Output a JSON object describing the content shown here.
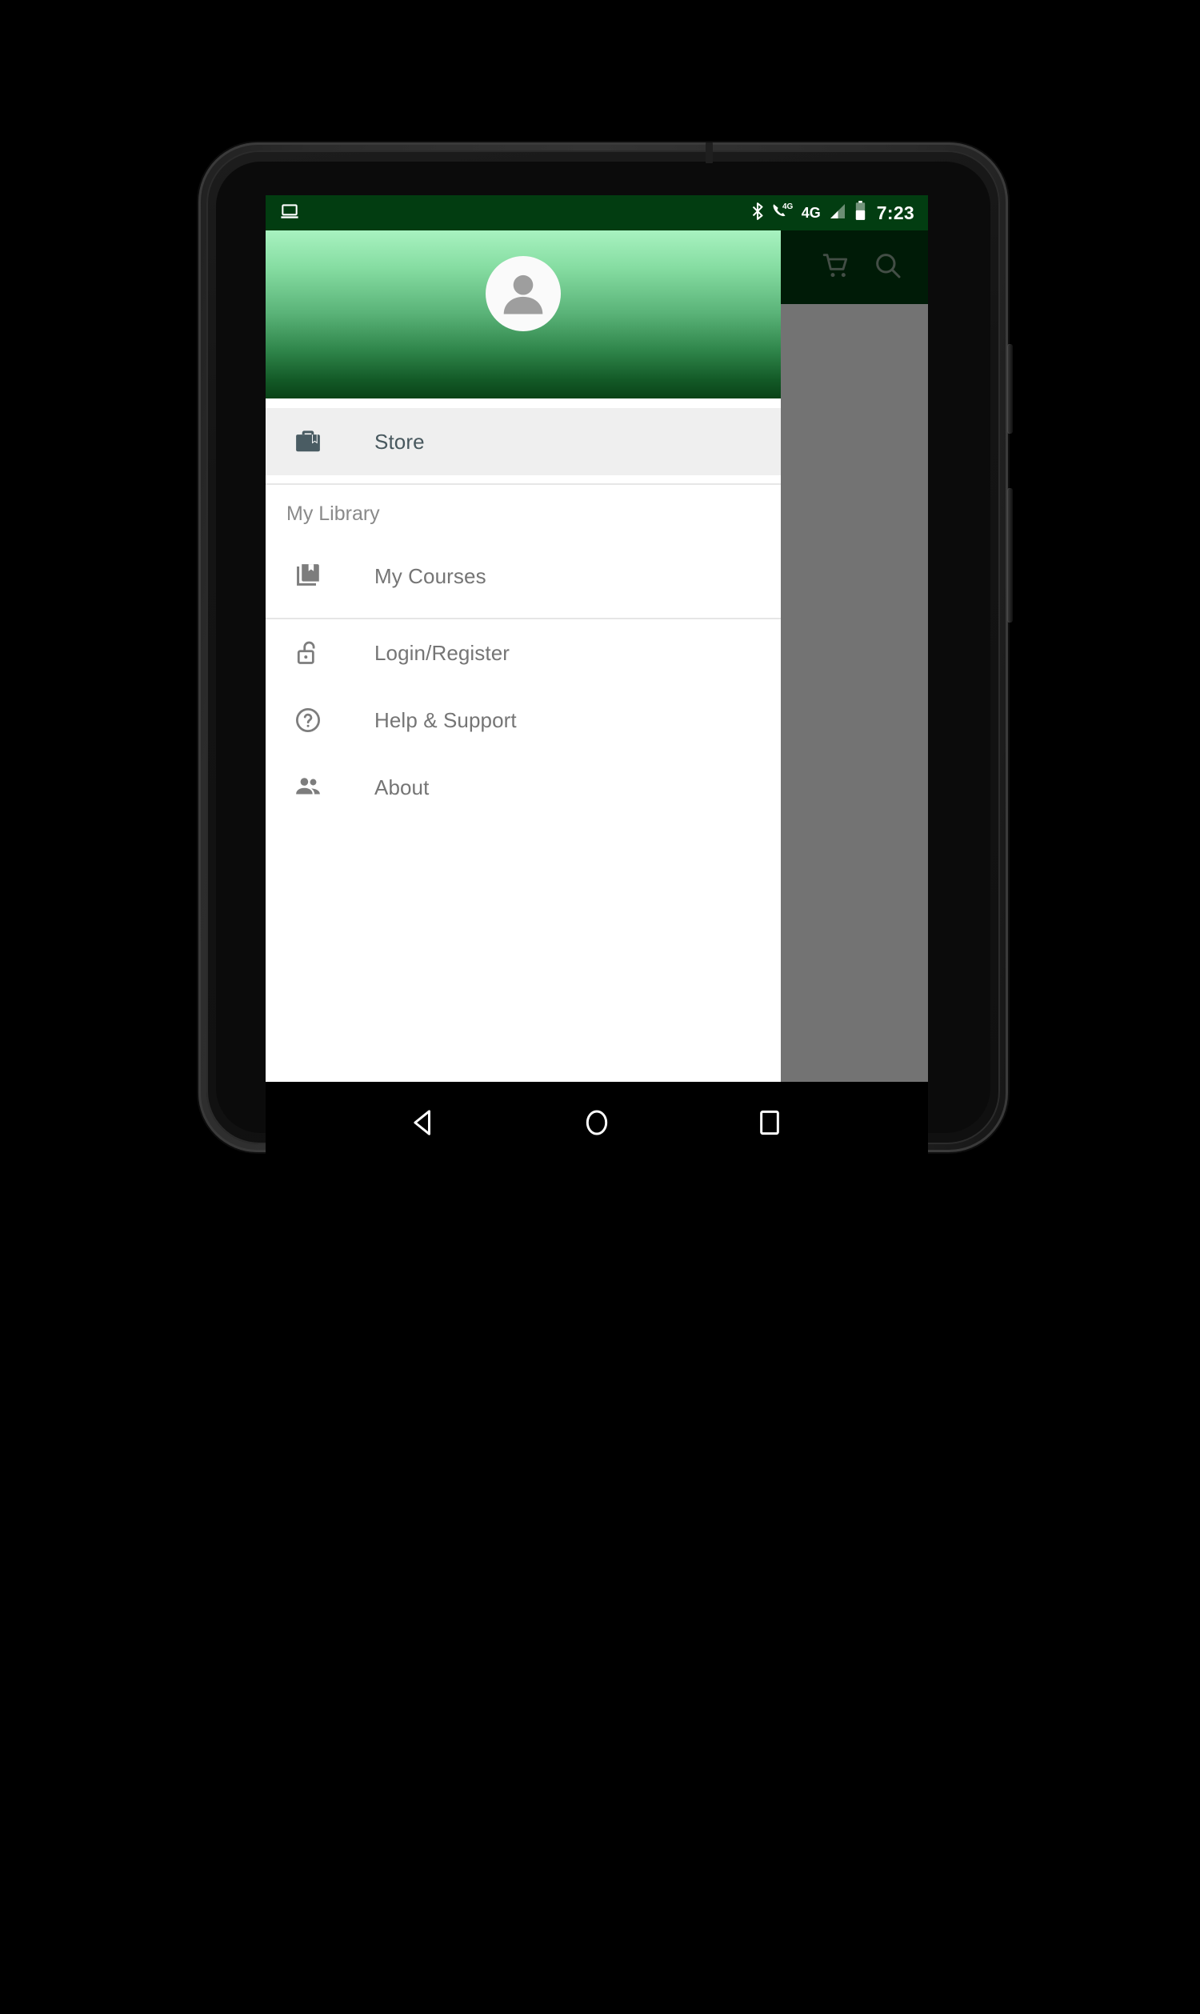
{
  "status_bar": {
    "left_icon": "laptop-cast-icon",
    "icons": [
      "bluetooth-icon",
      "volte-4g-call-icon",
      "4g-label",
      "signal-bars-icon",
      "battery-icon"
    ],
    "network_label": "4G",
    "clock": "7:23"
  },
  "app_bar": {
    "cart_icon": "shopping-cart-icon",
    "search_icon": "search-icon"
  },
  "drawer": {
    "header": {
      "avatar_icon": "person-avatar-icon",
      "gradient_top": "#a8f2c0",
      "gradient_bottom": "#0a4317"
    },
    "primary": [
      {
        "label": "Store",
        "icon": "briefcase-store-icon",
        "selected": true
      }
    ],
    "section_title": "My Library",
    "library": [
      {
        "label": "My Courses",
        "icon": "book-bookmark-icon",
        "selected": false
      }
    ],
    "secondary": [
      {
        "label": "Login/Register",
        "icon": "unlock-padlock-icon",
        "selected": false
      },
      {
        "label": "Help & Support",
        "icon": "help-circle-icon",
        "selected": false
      },
      {
        "label": "About",
        "icon": "people-group-icon",
        "selected": false
      }
    ]
  },
  "nav_bar": {
    "back": "back-triangle-icon",
    "home": "home-circle-icon",
    "recents": "recents-square-icon"
  },
  "colors": {
    "status_bar": "#023d11",
    "app_bar": "#023d11",
    "selected_item_bg": "#efefef",
    "selected_item_fg": "#48585e",
    "item_fg": "#757575",
    "scrim": "rgba(0,0,0,0.55)"
  }
}
